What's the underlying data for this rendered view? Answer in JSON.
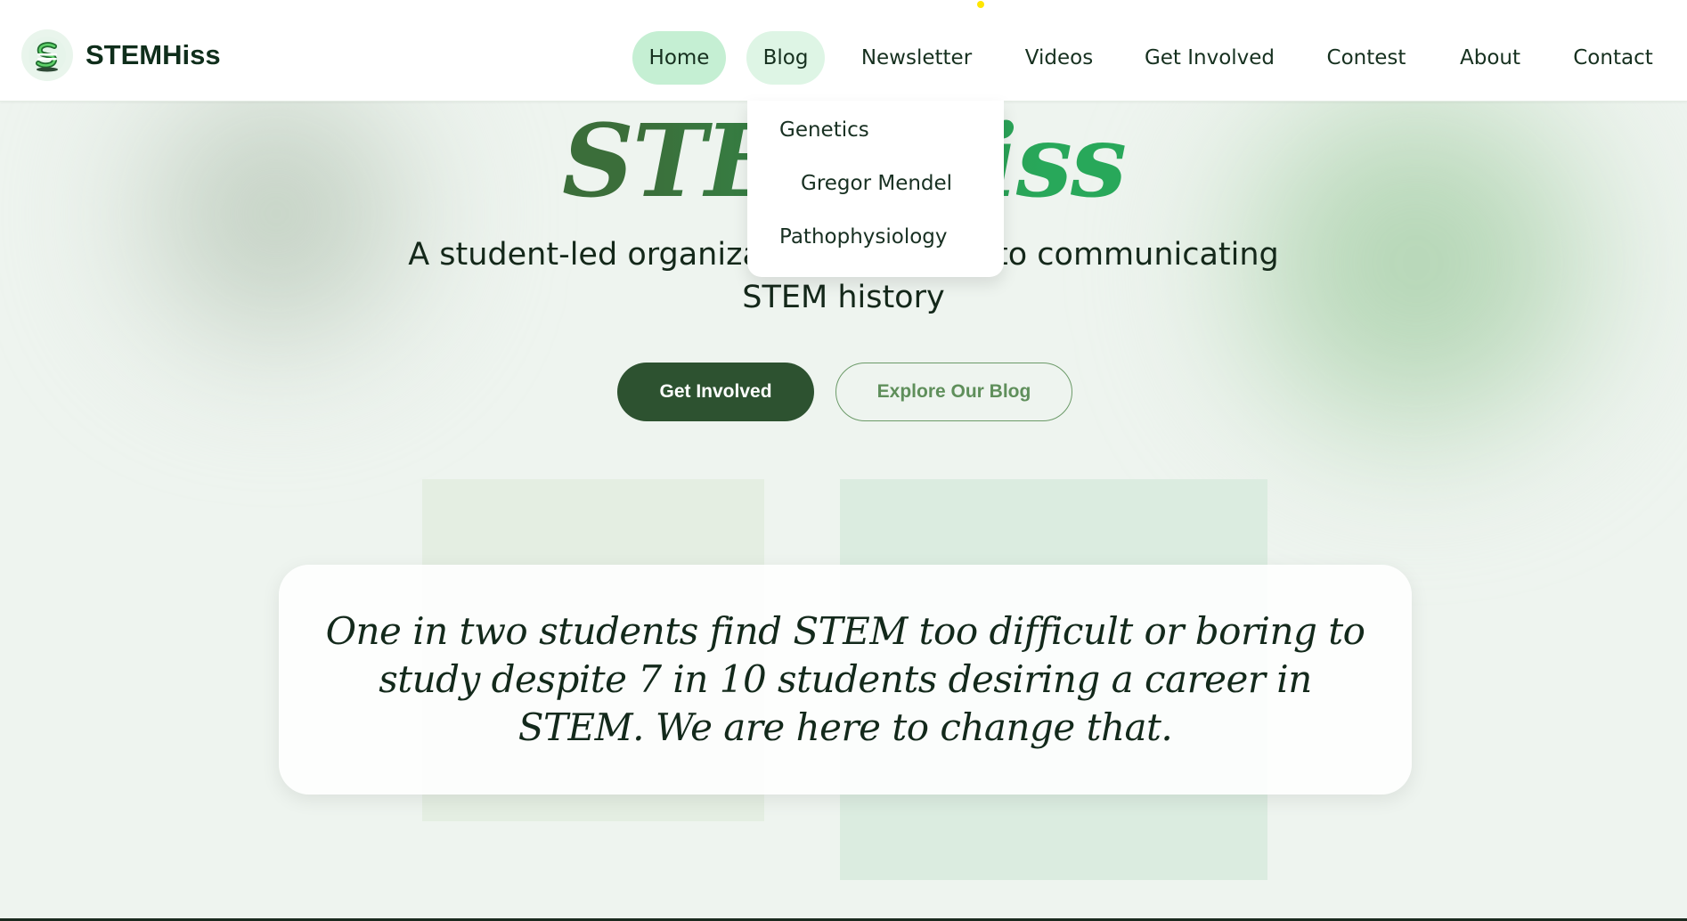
{
  "brand": {
    "name": "STEMHiss",
    "logo_icon": "snake-s-logo-icon"
  },
  "nav": {
    "items": [
      {
        "label": "Home",
        "state": "active"
      },
      {
        "label": "Blog",
        "state": "hover"
      },
      {
        "label": "Newsletter"
      },
      {
        "label": "Videos"
      },
      {
        "label": "Get Involved"
      },
      {
        "label": "Contest"
      },
      {
        "label": "About"
      },
      {
        "label": "Contact"
      }
    ]
  },
  "blog_dropdown": {
    "items": [
      {
        "label": "Genetics"
      },
      {
        "label": "Gregor Mendel",
        "indent": true
      },
      {
        "label": "Pathophysiology"
      }
    ]
  },
  "hero": {
    "title": "STEMHiss",
    "subtitle": "A student-led organization dedicated to communicating STEM history",
    "primary_button": "Get Involved",
    "secondary_button": "Explore Our Blog"
  },
  "quote": {
    "text": "One in two students find STEM too difficult or boring to study despite 7 in 10 students desiring a career in STEM. We are here to change that."
  },
  "colors": {
    "background": "#eef4ef",
    "active_pill": "#c5efd3",
    "primary_button": "#2d5230",
    "title_dark_green": "#3b6e3a",
    "title_bright_green": "#28a85a",
    "outline_green": "#6b9a68"
  }
}
